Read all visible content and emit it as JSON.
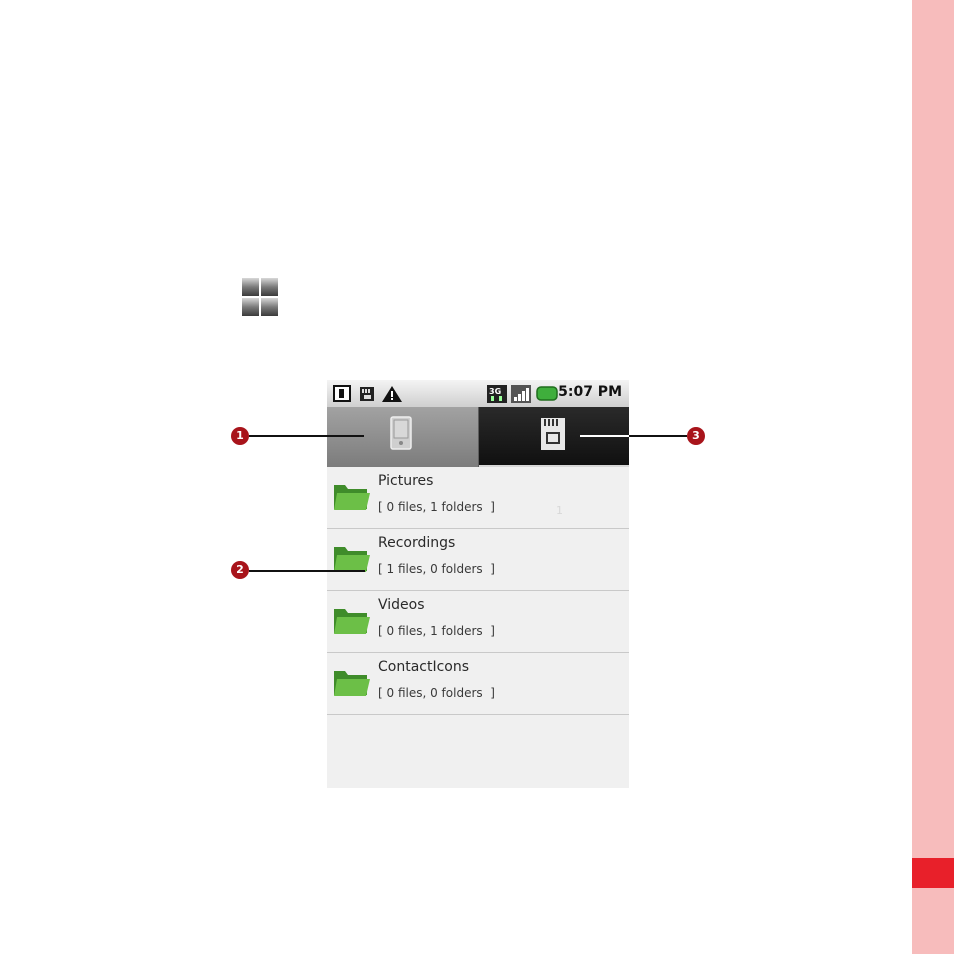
{
  "status_bar": {
    "time": "5:07 PM",
    "icons": [
      "sim-1-icon",
      "sd-card-status-icon",
      "warning-icon",
      "3g-icon",
      "signal-icon",
      "battery-icon"
    ]
  },
  "tabs": [
    {
      "name": "phone-memory",
      "icon": "phone-icon",
      "selected": false
    },
    {
      "name": "sd-card",
      "icon": "sd-card-icon",
      "selected": true
    }
  ],
  "folders": [
    {
      "name": "Pictures",
      "info": "[ 0 files, 1 folders  ]"
    },
    {
      "name": "Recordings",
      "info": "[ 1 files, 0 folders  ]"
    },
    {
      "name": "Videos",
      "info": "[ 0 files, 1 folders  ]"
    },
    {
      "name": "ContactIcons",
      "info": "[ 0 files, 0 folders  ]"
    }
  ],
  "faint_text": "1",
  "callouts": [
    "1",
    "2",
    "3"
  ],
  "colors": {
    "side_band": "#f7bcbc",
    "side_mark": "#e8202a",
    "callout": "#a8141b",
    "folder": "#5aa83a"
  }
}
